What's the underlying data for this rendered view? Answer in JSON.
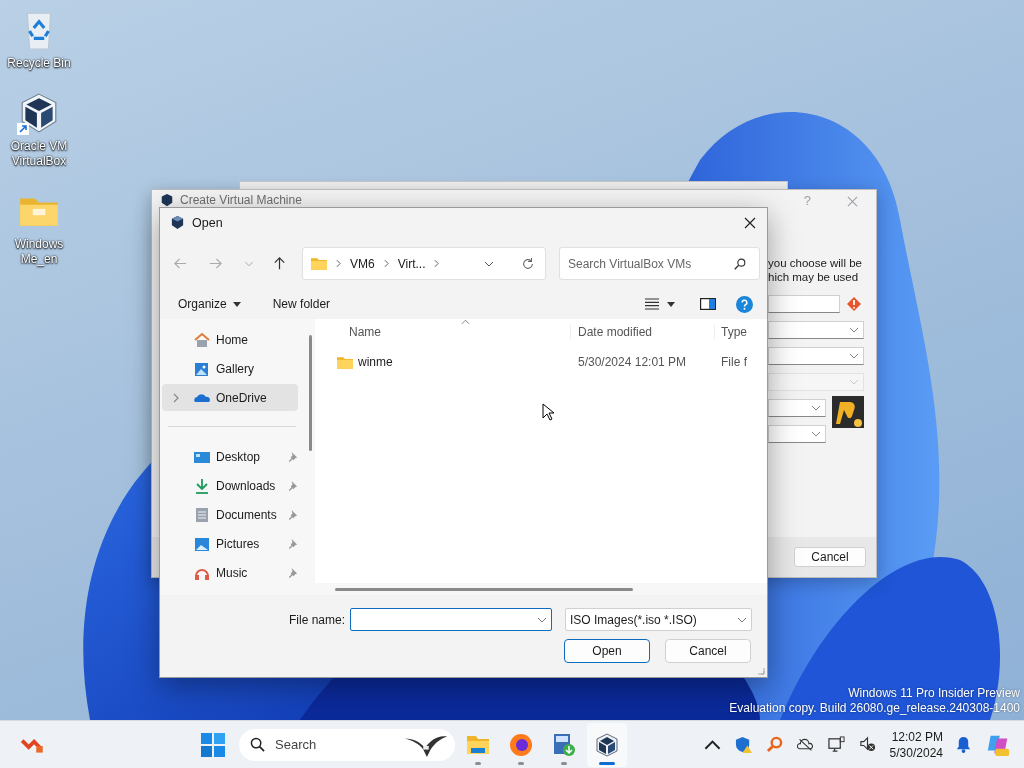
{
  "desktop_icons": [
    {
      "label": "Recycle Bin",
      "kind": "recycle",
      "shortcut": false
    },
    {
      "label": "Oracle VM VirtualBox",
      "kind": "virtualbox",
      "shortcut": true
    },
    {
      "label": "Windows Me_en",
      "kind": "folder",
      "shortcut": false
    }
  ],
  "background_window": {
    "title": "Create Virtual Machine",
    "help": "?",
    "description": [
      "you choose will be",
      "hich may be used"
    ],
    "fields": [
      {
        "kind": "text",
        "warning": true,
        "disabled": false
      },
      {
        "kind": "combo",
        "warning": false,
        "disabled": false
      },
      {
        "kind": "combo",
        "warning": false,
        "disabled": false
      },
      {
        "kind": "combo",
        "warning": false,
        "disabled": true
      },
      {
        "kind": "short-combo",
        "warning": false,
        "disabled": false
      },
      {
        "kind": "short-combo",
        "warning": false,
        "disabled": false
      }
    ],
    "cancel": "Cancel"
  },
  "open_dialog": {
    "title": "Open",
    "address": [
      "VM6",
      "Virt..."
    ],
    "search": {
      "placeholder": "Search VirtualBox VMs"
    },
    "toolbar": {
      "organize": "Organize",
      "new_folder": "New folder"
    },
    "nav_items": [
      {
        "label": "Home",
        "kind": "home",
        "selected": false,
        "expandable": false,
        "pinned": false
      },
      {
        "label": "Gallery",
        "kind": "gallery",
        "selected": false,
        "expandable": false,
        "pinned": false
      },
      {
        "label": "OneDrive",
        "kind": "cloud",
        "selected": true,
        "expandable": true,
        "pinned": false
      },
      {
        "label": "Desktop",
        "kind": "desktop",
        "selected": false,
        "expandable": false,
        "pinned": true
      },
      {
        "label": "Downloads",
        "kind": "download",
        "selected": false,
        "expandable": false,
        "pinned": true
      },
      {
        "label": "Documents",
        "kind": "document",
        "selected": false,
        "expandable": false,
        "pinned": true
      },
      {
        "label": "Pictures",
        "kind": "picture",
        "selected": false,
        "expandable": false,
        "pinned": true
      },
      {
        "label": "Music",
        "kind": "music",
        "selected": false,
        "expandable": false,
        "pinned": true
      }
    ],
    "columns": [
      "Name",
      "Date modified",
      "Type"
    ],
    "rows": [
      {
        "name": "winme",
        "date": "5/30/2024 12:01 PM",
        "type": "File f"
      }
    ],
    "file_name": {
      "label": "File name:"
    },
    "filter": "ISO Images(*.iso *.ISO)",
    "buttons": [
      {
        "label": "Open",
        "kind": "default"
      },
      {
        "label": "Cancel",
        "kind": "normal"
      }
    ]
  },
  "watermark": [
    "Windows 11 Pro Insider Preview",
    "Evaluation copy. Build 26080.ge_release.240308-1400"
  ],
  "taskbar": {
    "search": {
      "placeholder": "Search"
    },
    "apps": [
      {
        "kind": "explorer",
        "running": true,
        "active": false
      },
      {
        "kind": "firefox",
        "running": true,
        "active": false
      },
      {
        "kind": "installer",
        "running": true,
        "active": false
      },
      {
        "kind": "virtualbox",
        "running": true,
        "active": true
      }
    ],
    "clock": {
      "time": "12:02 PM",
      "date": "5/30/2024"
    }
  }
}
